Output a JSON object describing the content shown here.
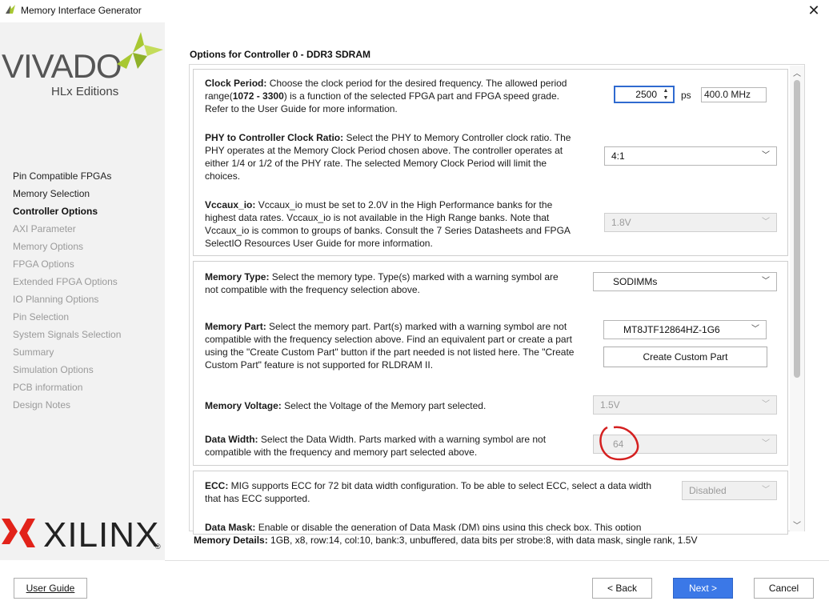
{
  "window": {
    "title": "Memory Interface Generator",
    "close_glyph": "✕"
  },
  "brand": {
    "vivado": "VIVADO",
    "hlx": "HLx Editions",
    "xilinx": "XILINX",
    "registered": "®"
  },
  "sidebar": {
    "items": [
      {
        "label": "Pin Compatible FPGAs",
        "state": "done"
      },
      {
        "label": "Memory Selection",
        "state": "done"
      },
      {
        "label": "Controller Options",
        "state": "active"
      },
      {
        "label": "AXI Parameter",
        "state": "pending"
      },
      {
        "label": "Memory Options",
        "state": "pending"
      },
      {
        "label": "FPGA Options",
        "state": "pending"
      },
      {
        "label": "Extended FPGA Options",
        "state": "pending"
      },
      {
        "label": "IO Planning Options",
        "state": "pending"
      },
      {
        "label": "Pin Selection",
        "state": "pending"
      },
      {
        "label": "System Signals Selection",
        "state": "pending"
      },
      {
        "label": "Summary",
        "state": "pending"
      },
      {
        "label": "Simulation Options",
        "state": "pending"
      },
      {
        "label": "PCB information",
        "state": "pending"
      },
      {
        "label": "Design Notes",
        "state": "pending"
      }
    ]
  },
  "main": {
    "heading": "Options for Controller 0 - DDR3 SDRAM",
    "clock": {
      "label": "Clock Period:",
      "text_a": " Choose the clock period for the desired frequency. The allowed period range(",
      "range": "1072 - 3300",
      "text_b": ") is a function of the selected FPGA part and FPGA speed grade. Refer to the User Guide for more information.",
      "value": "2500",
      "unit": "ps",
      "frequency": "400.0 MHz"
    },
    "phy_ratio": {
      "label": "PHY to Controller Clock Ratio:",
      "text": " Select the PHY to Memory Controller clock ratio. The PHY operates at the Memory Clock Period chosen above. The controller operates at either 1/4 or 1/2 of the PHY rate. The selected Memory Clock Period will limit the choices.",
      "value": "4:1"
    },
    "vccaux": {
      "label": "Vccaux_io:",
      "text": " Vccaux_io must be set to 2.0V in the High Performance banks for the highest data rates. Vccaux_io is not available in the High Range banks. Note that Vccaux_io is common to groups of banks. Consult the 7 Series Datasheets and FPGA SelectIO Resources User Guide for more information.",
      "value": "1.8V"
    },
    "memory_type": {
      "label": "Memory Type:",
      "text": " Select the memory type. Type(s) marked with a warning symbol are not compatible with the frequency selection above.",
      "value": "SODIMMs"
    },
    "memory_part": {
      "label": "Memory Part:",
      "text": " Select the memory part. Part(s) marked with a warning symbol are not compatible with the frequency selection above. Find an equivalent part or create a part using the \"Create Custom Part\" button if the part needed is not listed here. The \"Create Custom Part\" feature is not supported for RLDRAM II.",
      "value": "MT8JTF12864HZ-1G6",
      "create_button": "Create Custom Part"
    },
    "voltage": {
      "label": "Memory Voltage:",
      "text": " Select the Voltage of the Memory part selected.",
      "value": "1.5V"
    },
    "data_width": {
      "label": "Data Width:",
      "text": " Select the Data Width. Parts marked with a warning symbol are not compatible with the frequency and memory part selected above.",
      "value": "64"
    },
    "ecc": {
      "label": "ECC:",
      "text": " MIG supports ECC for 72 bit data width configuration. To be able to select ECC, select a data width that has ECC supported.",
      "value": "Disabled"
    },
    "data_mask": {
      "label": "Data Mask:",
      "text": " Enable or disable the generation of Data Mask (DM) pins using this check box. This option"
    },
    "details": {
      "label": "Memory Details:",
      "text": " 1GB, x8, row:14, col:10, bank:3, unbuffered, data bits per strobe:8, with data mask, single rank, 1.5V"
    }
  },
  "footer": {
    "user_guide": "User Guide",
    "back": "< Back",
    "next": "Next >",
    "cancel": "Cancel"
  },
  "colors": {
    "accent": "#3b78e7",
    "vivado_green": "#a8c832",
    "xilinx_red": "#e2231a",
    "annotation": "#d42020"
  }
}
